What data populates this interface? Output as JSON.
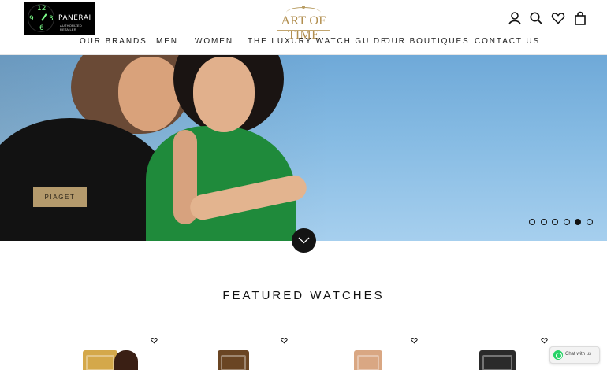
{
  "header": {
    "retailer_badge": {
      "brand": "PANERAI",
      "subtitle": "AUTHORIZED RETAILER",
      "dial_numerals": [
        "12",
        "9",
        "3",
        "6"
      ]
    },
    "logo_text": "ART OF TIME",
    "icons": [
      "account-icon",
      "search-icon",
      "wishlist-heart-icon",
      "shopping-bag-icon"
    ]
  },
  "nav": {
    "items": [
      {
        "label": "OUR BRANDS"
      },
      {
        "label": "MEN"
      },
      {
        "label": "WOMEN"
      },
      {
        "label": "THE LUXURY WATCH GUIDE"
      },
      {
        "label": "OUR BOUTIQUES"
      },
      {
        "label": "CONTACT US"
      }
    ]
  },
  "hero": {
    "cta_label": "PIAGET",
    "slide_count": 6,
    "active_slide": 5
  },
  "featured": {
    "title": "FEATURED WATCHES",
    "products": [
      {
        "name": "watch-gold-square",
        "color": "#d4a84a"
      },
      {
        "name": "watch-brown-tonneau",
        "color": "#6a4523"
      },
      {
        "name": "watch-rose-gold-bracelet",
        "color": "#d9a783"
      },
      {
        "name": "watch-black-bracelet",
        "color": "#2a2a2a"
      }
    ]
  },
  "chat": {
    "label": "Chat with us"
  },
  "colors": {
    "accent": "#b49a6c",
    "logo_gold": "#b28f50",
    "sky": "#86bbe3",
    "whatsapp": "#25d366"
  }
}
